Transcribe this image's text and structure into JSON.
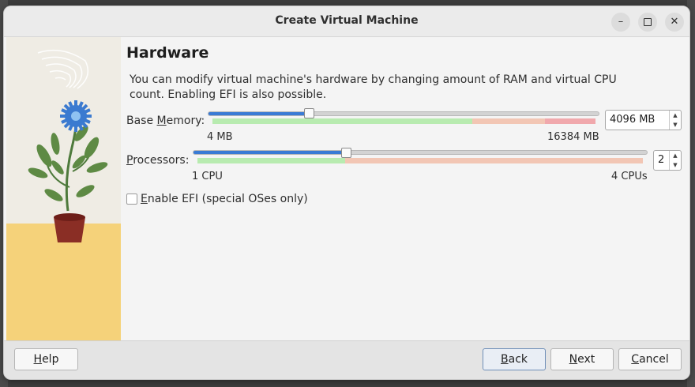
{
  "window": {
    "title": "Create Virtual Machine",
    "minimize_icon": "minimize-icon",
    "maximize_icon": "maximize-icon",
    "close_icon": "close-icon"
  },
  "page": {
    "heading": "Hardware",
    "description": "You can modify virtual machine's hardware by changing amount of RAM and virtual CPU count. Enabling EFI is also possible."
  },
  "memory": {
    "label_prefix": "Base ",
    "label_mnemonic": "M",
    "label_suffix": "emory:",
    "min_label": "4 MB",
    "max_label": "16384 MB",
    "value": "4096 MB",
    "slider_fraction": 0.25
  },
  "processors": {
    "label_mnemonic": "P",
    "label_suffix": "rocessors:",
    "min_label": "1 CPU",
    "max_label": "4 CPUs",
    "value": "2",
    "slider_fraction": 0.333
  },
  "efi": {
    "label_mnemonic": "E",
    "label_suffix": "nable EFI (special OSes only)",
    "checked": false
  },
  "buttons": {
    "help": {
      "mnemonic": "H",
      "rest": "elp"
    },
    "back": {
      "mnemonic": "B",
      "rest": "ack"
    },
    "next": {
      "mnemonic": "N",
      "rest": "ext"
    },
    "cancel": {
      "mnemonic": "C",
      "rest": "ancel"
    }
  },
  "colors": {
    "accent": "#3a7bd5",
    "zone_ok": "#b8ebb0",
    "zone_warn": "#f2c6b4",
    "zone_bad": "#f0a8ac",
    "sidebar_top": "#efece4",
    "sidebar_bottom": "#f5d27a"
  }
}
